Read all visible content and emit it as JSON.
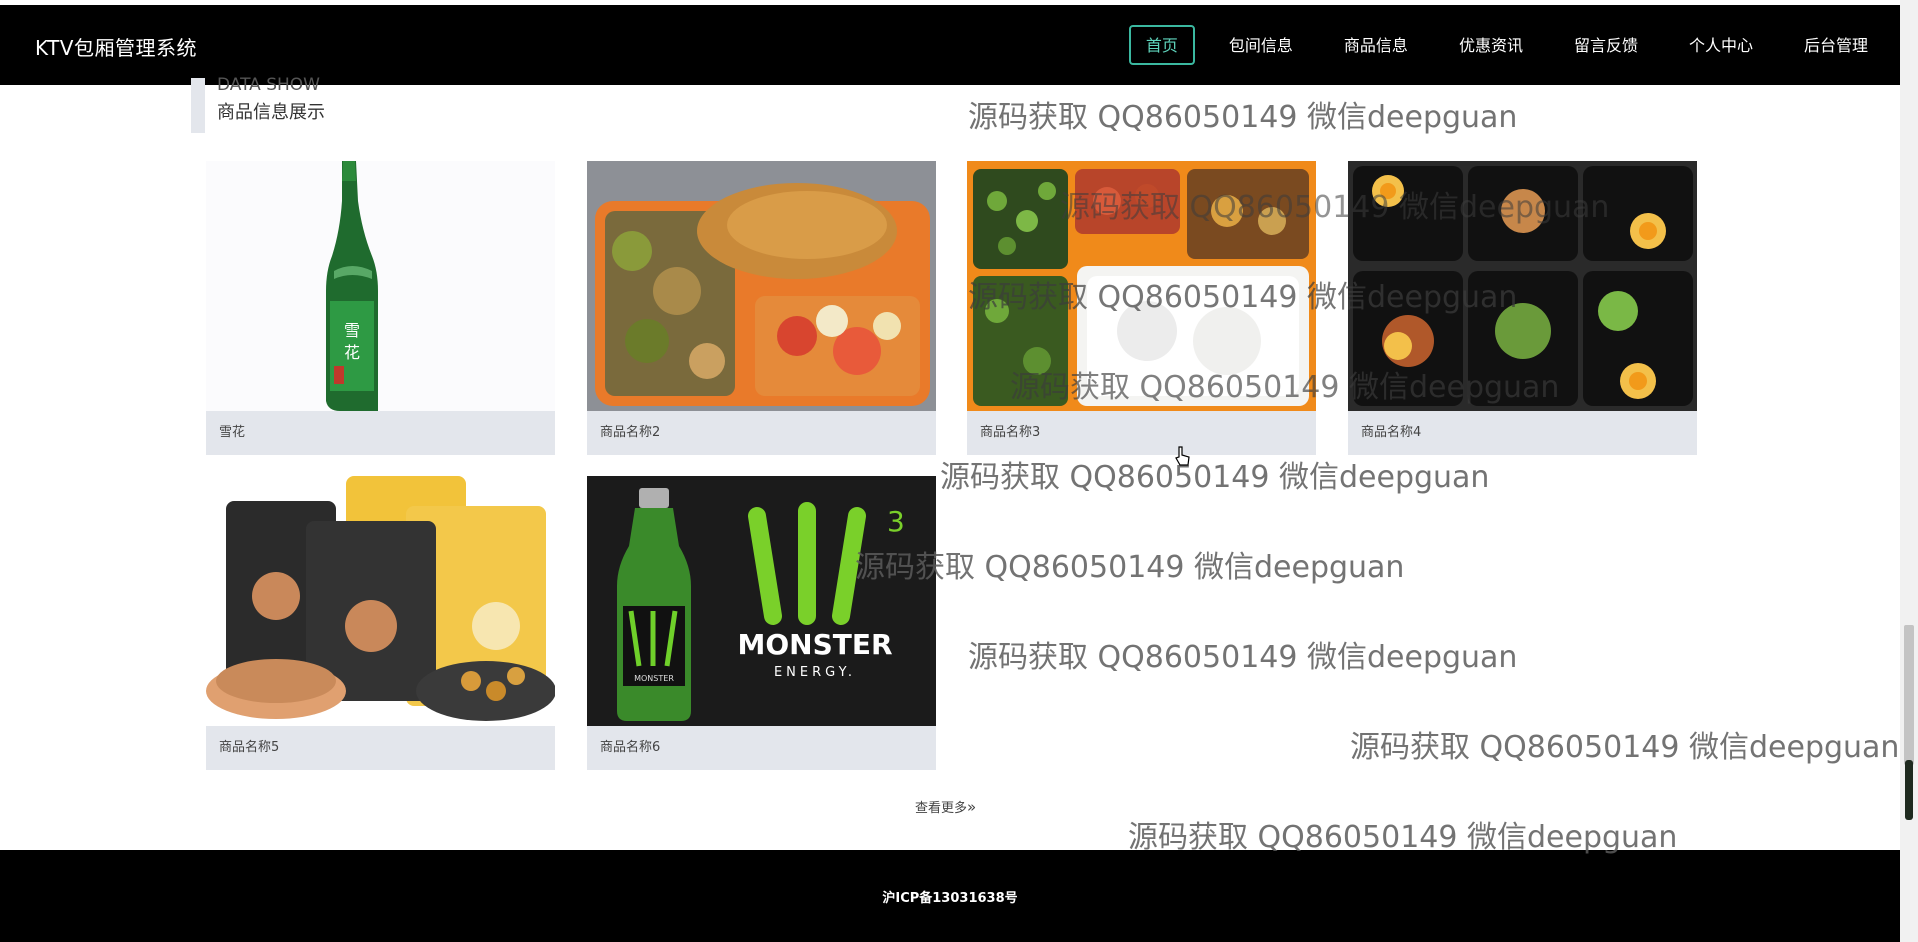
{
  "header": {
    "brand": "KTV包厢管理系统",
    "nav": [
      "首页",
      "包间信息",
      "商品信息",
      "优惠资讯",
      "留言反馈",
      "个人中心",
      "后台管理"
    ],
    "active_index": 0
  },
  "section": {
    "title_en": "DATA SHOW",
    "title_cn": "商品信息展示"
  },
  "products": [
    {
      "name": "雪花",
      "image": "snow-beer-bottle"
    },
    {
      "name": "商品名称2",
      "image": "fried-chicken-bento"
    },
    {
      "name": "商品名称3",
      "image": "rice-bento"
    },
    {
      "name": "商品名称4",
      "image": "noodle-boxes"
    },
    {
      "name": "商品名称5",
      "image": "biscuit-snacks"
    },
    {
      "name": "商品名称6",
      "image": "monster-energy-drink"
    }
  ],
  "more_label": "查看更多",
  "more_icon": "double-chevron-right-icon",
  "footer": {
    "icp": "沪ICP备13031638号"
  },
  "watermark": "源码获取 QQ86050149 微信deepguan",
  "colors": {
    "header_bg": "#000000",
    "active_nav": "#3bb8a0",
    "label_bg": "#e3e6ec"
  }
}
